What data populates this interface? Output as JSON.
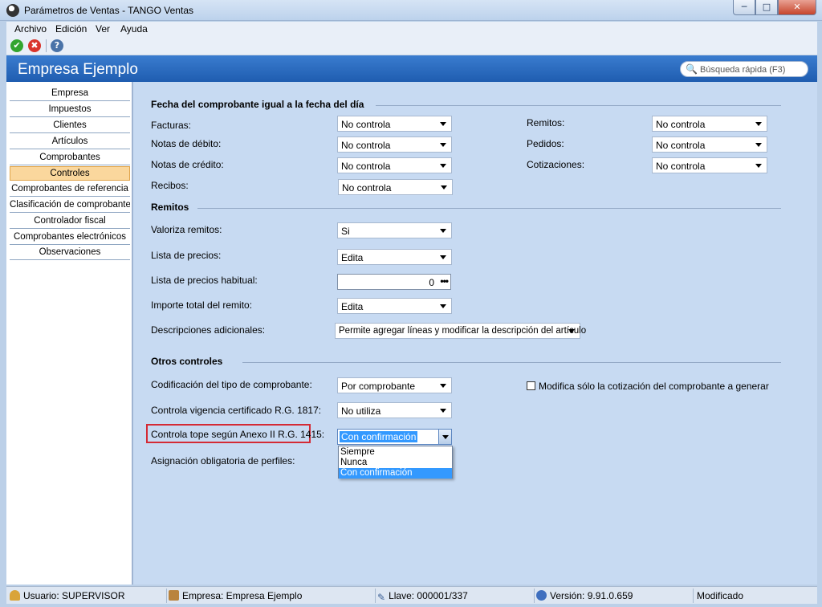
{
  "window": {
    "title": "Parámetros de Ventas - TANGO Ventas",
    "min": "─",
    "max": "□",
    "close": "✕"
  },
  "menu": {
    "items": [
      {
        "label": "Archivo"
      },
      {
        "label": "Edición"
      },
      {
        "label": "Ver"
      },
      {
        "label": "Ayuda"
      }
    ]
  },
  "toolbar": {
    "accept_icon": "✔",
    "cancel_icon": "✖",
    "help_icon": "?"
  },
  "header": {
    "company": "Empresa Ejemplo",
    "search_placeholder": "Búsqueda rápida (F3)",
    "search_icon": "🔍"
  },
  "sidebar": {
    "items": [
      {
        "label": "Empresa"
      },
      {
        "label": "Impuestos"
      },
      {
        "label": "Clientes"
      },
      {
        "label": "Artículos"
      },
      {
        "label": "Comprobantes"
      },
      {
        "label": "Controles",
        "active": true
      },
      {
        "label": "Comprobantes de referencia"
      },
      {
        "label": "Clasificación de comprobantes"
      },
      {
        "label": "Controlador fiscal"
      },
      {
        "label": "Comprobantes electrónicos"
      },
      {
        "label": "Observaciones"
      }
    ]
  },
  "sections": {
    "fecha": {
      "title": "Fecha del comprobante igual a la fecha del día",
      "facturas": {
        "label": "Facturas:",
        "value": "No controla"
      },
      "notas_debito": {
        "label": "Notas de débito:",
        "value": "No controla"
      },
      "notas_credito": {
        "label": "Notas de crédito:",
        "value": "No controla"
      },
      "recibos": {
        "label": "Recibos:",
        "value": "No controla"
      },
      "remitos": {
        "label": "Remitos:",
        "value": "No controla"
      },
      "pedidos": {
        "label": "Pedidos:",
        "value": "No controla"
      },
      "cotizaciones": {
        "label": "Cotizaciones:",
        "value": "No controla"
      }
    },
    "remitos": {
      "title": "Remitos",
      "valoriza": {
        "label": "Valoriza remitos:",
        "value": "Si"
      },
      "lista_precios": {
        "label": "Lista de precios:",
        "value": "Edita"
      },
      "lista_habitual": {
        "label": "Lista de precios habitual:",
        "value": "0",
        "ellipsis": "•••"
      },
      "importe_total": {
        "label": "Importe total del remito:",
        "value": "Edita"
      },
      "descripciones": {
        "label": "Descripciones adicionales:",
        "value": "Permite agregar líneas y modificar la descripción del artículo"
      }
    },
    "otros": {
      "title": "Otros controles",
      "codificacion": {
        "label": "Codificación del tipo de comprobante:",
        "value": "Por comprobante"
      },
      "vigencia": {
        "label": "Controla vigencia certificado R.G. 1817:",
        "value": "No utiliza"
      },
      "tope": {
        "label": "Controla tope según Anexo II R.G. 1415:",
        "value": "Con confirmación",
        "options": [
          "Siempre",
          "Nunca",
          "Con confirmación"
        ]
      },
      "asignacion": {
        "label": "Asignación obligatoria de perfiles:"
      },
      "modifica_cotizacion": {
        "label": "Modifica sólo la cotización del comprobante a generar",
        "checked": false
      }
    }
  },
  "status": {
    "usuario": "Usuario: SUPERVISOR",
    "empresa": "Empresa: Empresa Ejemplo",
    "llave": "Llave: 000001/337",
    "key_icon": "✎",
    "version": "Versión: 9.91.0.659",
    "estado": "Modificado"
  }
}
